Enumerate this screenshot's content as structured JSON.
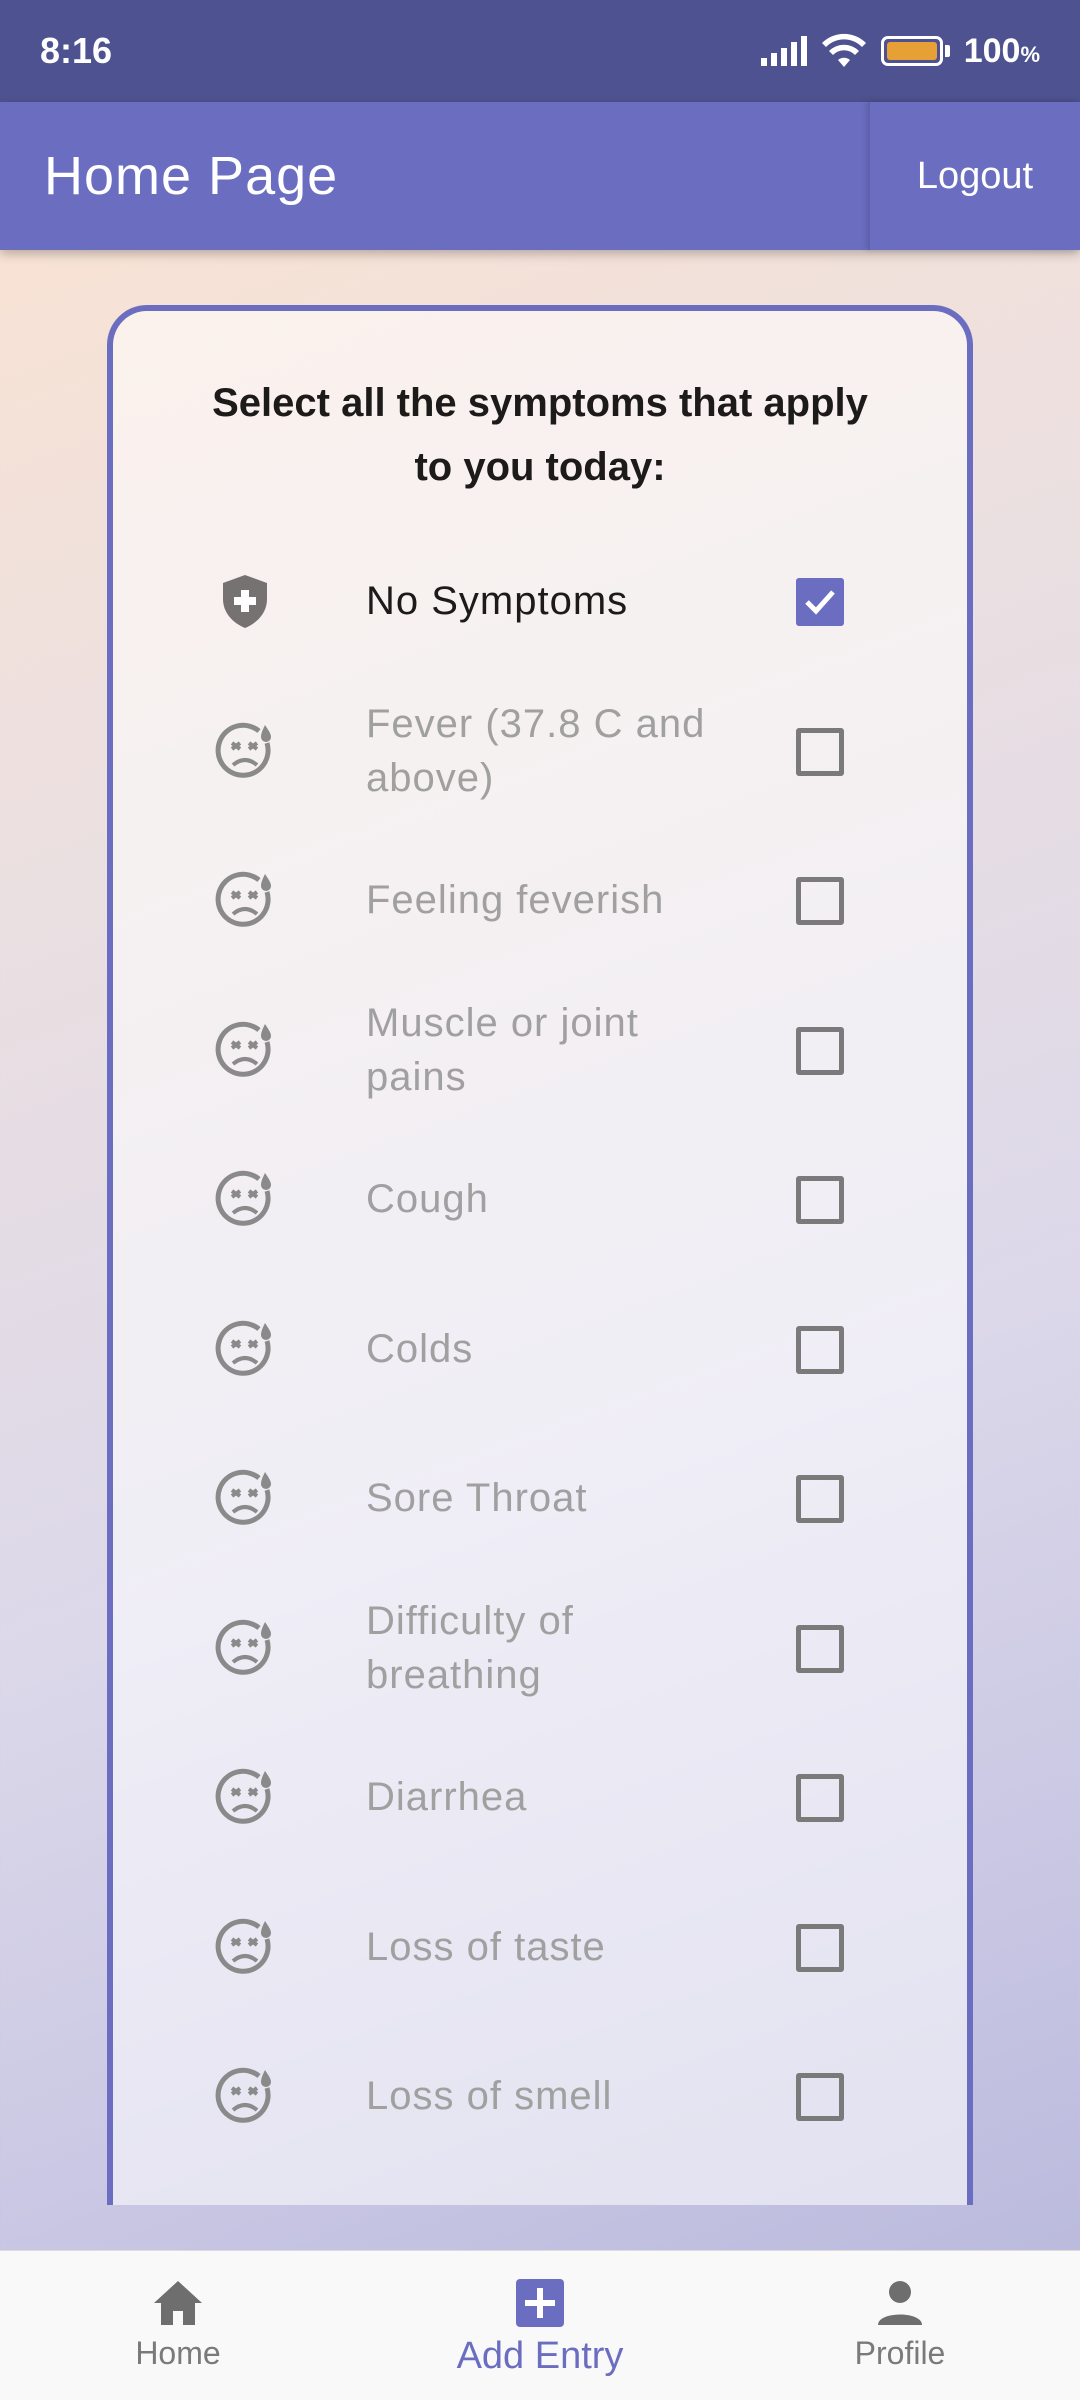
{
  "status_bar": {
    "time": "8:16",
    "battery": "100",
    "battery_unit": "%"
  },
  "app_bar": {
    "title": "Home Page",
    "logout_label": "Logout"
  },
  "card": {
    "title_line1": "Select all the symptoms that apply",
    "title_line2": "to you today:"
  },
  "symptoms": [
    {
      "label": "No Symptoms",
      "icon": "shield-plus-icon",
      "checked": true
    },
    {
      "label": "Fever (37.8 C and above)",
      "icon": "sick-face-icon",
      "checked": false
    },
    {
      "label": "Feeling feverish",
      "icon": "sick-face-icon",
      "checked": false
    },
    {
      "label": "Muscle or joint pains",
      "icon": "sick-face-icon",
      "checked": false
    },
    {
      "label": "Cough",
      "icon": "sick-face-icon",
      "checked": false
    },
    {
      "label": "Colds",
      "icon": "sick-face-icon",
      "checked": false
    },
    {
      "label": "Sore Throat",
      "icon": "sick-face-icon",
      "checked": false
    },
    {
      "label": "Difficulty of breathing",
      "icon": "sick-face-icon",
      "checked": false
    },
    {
      "label": "Diarrhea",
      "icon": "sick-face-icon",
      "checked": false
    },
    {
      "label": "Loss of taste",
      "icon": "sick-face-icon",
      "checked": false
    },
    {
      "label": "Loss of smell",
      "icon": "sick-face-icon",
      "checked": false
    }
  ],
  "bottom_nav": {
    "home_label": "Home",
    "add_entry_label": "Add Entry",
    "profile_label": "Profile"
  },
  "colors": {
    "accent": "#6b6ec0",
    "status_bar": "#4e5290",
    "inactive_text": "#a0a0a0"
  }
}
